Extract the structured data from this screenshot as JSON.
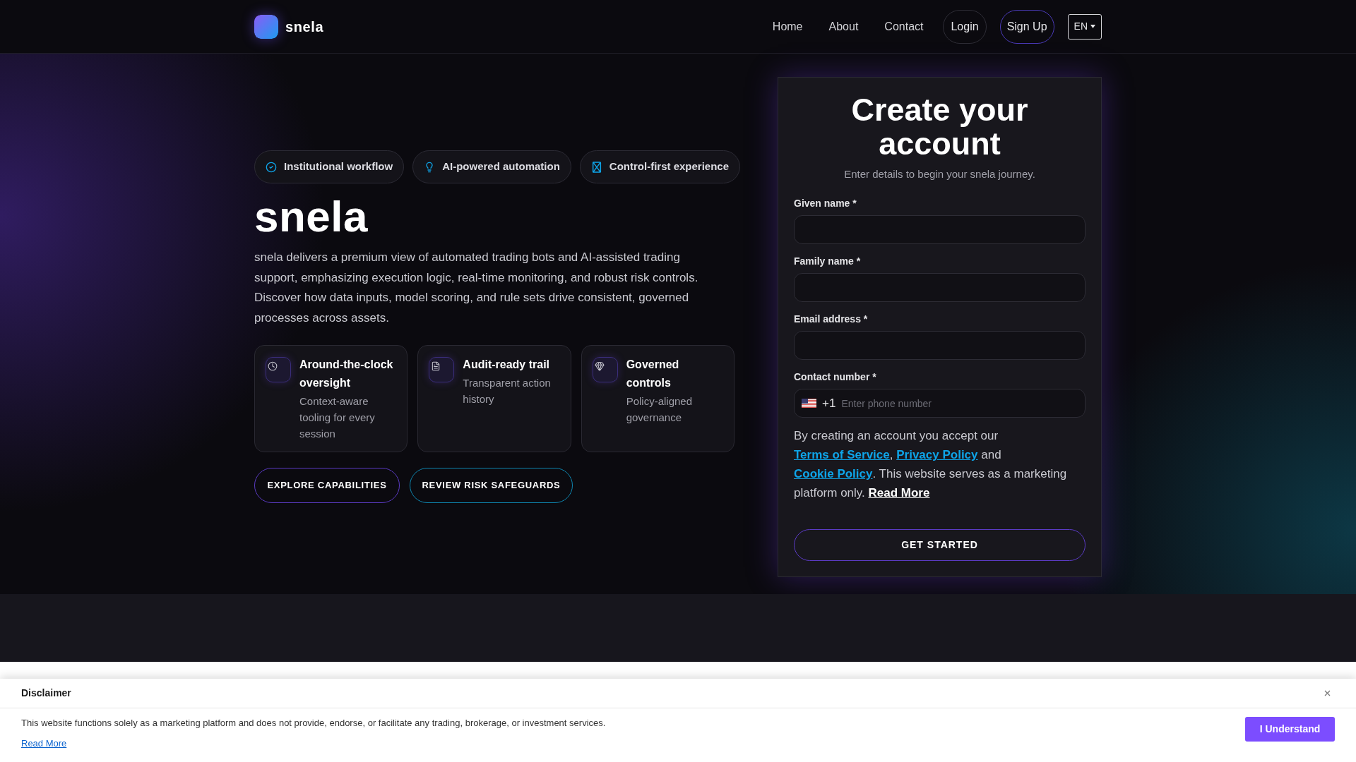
{
  "header": {
    "brand": "snela",
    "nav": [
      {
        "label": "Home",
        "kind": "link"
      },
      {
        "label": "About",
        "kind": "link"
      },
      {
        "label": "Contact",
        "kind": "link"
      },
      {
        "label": "Login",
        "kind": "outline"
      },
      {
        "label": "Sign Up",
        "kind": "accent"
      }
    ],
    "language": "EN"
  },
  "hero": {
    "badges": [
      "Institutional workflow",
      "AI-powered automation",
      "Control-first experience"
    ],
    "title": "snela",
    "description": "snela delivers a premium view of automated trading bots and AI-assisted trading support, emphasizing execution logic, real-time monitoring, and robust risk controls. Discover how data inputs, model scoring, and rule sets drive consistent, governed processes across assets.",
    "features": [
      {
        "title": "Around-the-clock oversight",
        "text": "Context-aware tooling for every session"
      },
      {
        "title": "Audit-ready trail",
        "text": "Transparent action history"
      },
      {
        "title": "Governed controls",
        "text": "Policy-aligned governance"
      }
    ],
    "actions": [
      {
        "label": "EXPLORE CAPABILITIES",
        "kind": "primary"
      },
      {
        "label": "REVIEW RISK SAFEGUARDS",
        "kind": "secondary"
      }
    ]
  },
  "signup_form": {
    "title": "Create your account",
    "subtitle": "Enter details to begin your snela journey.",
    "fields": [
      {
        "label": "Given name *",
        "kind": "text"
      },
      {
        "label": "Family name *",
        "kind": "text"
      },
      {
        "label": "Email address *",
        "kind": "text"
      },
      {
        "label": "Contact number *",
        "kind": "phone",
        "country_code": "+1",
        "placeholder": "Enter phone number"
      }
    ],
    "consent": [
      {
        "text": "By creating an account you accept our ",
        "kind": "text"
      },
      {
        "text": "Terms of Service",
        "kind": "link"
      },
      {
        "text": ", ",
        "kind": "text"
      },
      {
        "text": "Privacy Policy",
        "kind": "link"
      },
      {
        "text": " and ",
        "kind": "text"
      },
      {
        "text": "Cookie Policy",
        "kind": "link"
      },
      {
        "text": ". This website serves as a marketing platform only. ",
        "kind": "text"
      },
      {
        "text": "Read More",
        "kind": "strong_link"
      }
    ],
    "submit": "GET STARTED"
  },
  "disclaimer": {
    "title": "Disclaimer",
    "text": "This website functions solely as a marketing platform and does not provide, endorse, or facilitate any trading, brokerage, or investment services.",
    "link": "Read More",
    "button": "I Understand"
  }
}
